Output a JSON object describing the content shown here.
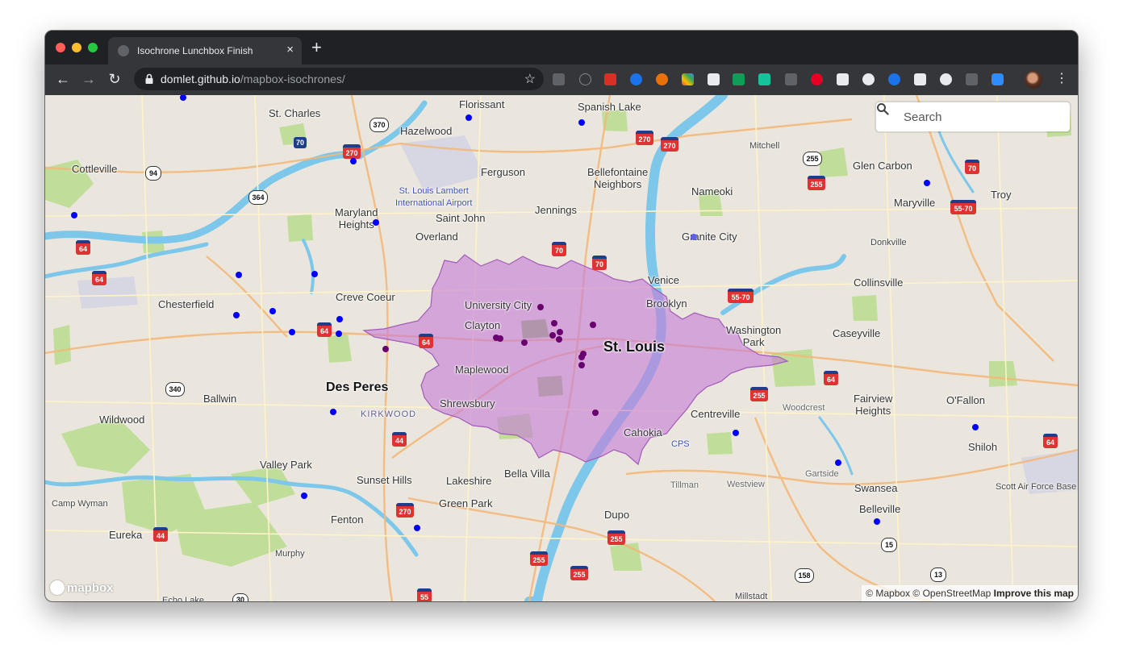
{
  "browser": {
    "tab_title": "Isochrone Lunchbox Finish",
    "tab_close": "×",
    "new_tab": "+",
    "url_host": "domlet.github.io",
    "url_path": "/mapbox-isochrones/",
    "back": "←",
    "forward": "→",
    "reload": "↻",
    "bookmark": "☆",
    "menu": "⋮"
  },
  "search": {
    "placeholder": "Search"
  },
  "map": {
    "labels": {
      "st_charles": "St. Charles",
      "florissant": "Florissant",
      "spanish_lake": "Spanish Lake",
      "hazelwood": "Hazelwood",
      "mitchell": "Mitchell",
      "cottleville": "Cottleville",
      "ferguson": "Ferguson",
      "bellefontaine": "Bellefontaine\nNeighbors",
      "glen_carbon": "Glen Carbon",
      "airport": "St. Louis Lambert\nInternational Airport",
      "nameoki": "Nameoki",
      "maryville": "Maryville",
      "troy": "Troy",
      "maryland_heights": "Maryland\nHeights",
      "saint_john": "Saint John",
      "jennings": "Jennings",
      "overland": "Overland",
      "granite_city": "Granite City",
      "donkville": "Donkville",
      "venice": "Venice",
      "collinsville": "Collinsville",
      "chesterfield": "Chesterfield",
      "creve_coeur": "Creve Coeur",
      "university_city": "University City",
      "brooklyn": "Brooklyn",
      "clayton": "Clayton",
      "washington_park": "Washington\nPark",
      "caseyville": "Caseyville",
      "st_louis": "St. Louis",
      "maplewood": "Maplewood",
      "des_peres": "Des Peres",
      "ballwin": "Ballwin",
      "shrewsbury": "Shrewsbury",
      "woodcrest": "Woodcrest",
      "fairview_heights": "Fairview\nHeights",
      "ofallon": "O'Fallon",
      "wildwood": "Wildwood",
      "kirkwood": "KIRKWOOD",
      "centreville": "Centreville",
      "cahokia": "Cahokia",
      "cps": "CPS",
      "shiloh": "Shiloh",
      "valley_park": "Valley Park",
      "bella_villa": "Bella Villa",
      "gartside": "Gartside",
      "sunset_hills": "Sunset Hills",
      "lakeshire": "Lakeshire",
      "tillman": "Tillman",
      "westview": "Westview",
      "swansea": "Swansea",
      "scott_afb": "Scott Air Force Base",
      "camp_wyman": "Camp Wyman",
      "green_park": "Green Park",
      "fenton": "Fenton",
      "dupo": "Dupo",
      "belleville": "Belleville",
      "eureka": "Eureka",
      "murphy": "Murphy",
      "millstadt": "Millstadt",
      "echo_lake": "Echo Lake"
    },
    "shields": {
      "i270_a": "270",
      "i270_b": "270",
      "i270_c": "270",
      "i270_d": "270",
      "us370": "370",
      "us70_a": "70",
      "us70_b": "70",
      "us70_c": "70",
      "us70_d": "70",
      "mo94": "94",
      "mo364": "364",
      "i64_a": "64",
      "i64_b": "64",
      "i64_c": "64",
      "i64_d": "64",
      "i64_e": "64",
      "i64_f": "64",
      "i64_g": "64",
      "i255_a": "255",
      "i255_b": "255",
      "i255_c": "255",
      "i255_d": "255",
      "i255_e": "255",
      "i255_f": "255",
      "i5570_a": "55-70",
      "i5570_b": "55-70",
      "mo340": "340",
      "i44_a": "44",
      "i44_b": "44",
      "i55": "55",
      "il15": "15",
      "il158": "158",
      "il13": "13",
      "mo30": "30"
    }
  },
  "logo": "mapbox",
  "attribution": {
    "text": "© Mapbox © OpenStreetMap",
    "link": "Improve this map"
  },
  "colors": {
    "isochrone_fill": "#c77dd6",
    "isochrone_stroke": "#a35ab8",
    "marker_inside": "#6a006f",
    "marker_outside": "#0000ff",
    "water": "#7cc7ea",
    "land": "#eae6de",
    "park": "#b9dc8e"
  }
}
